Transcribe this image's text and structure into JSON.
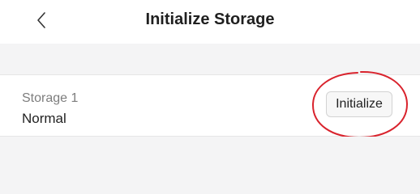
{
  "header": {
    "title": "Initialize Storage",
    "back_icon": "chevron-left-icon"
  },
  "storage": {
    "name": "Storage 1",
    "status": "Normal",
    "button_label": "Initialize"
  },
  "colors": {
    "background": "#f4f4f5",
    "surface": "#ffffff",
    "annotation": "#d9232d"
  }
}
